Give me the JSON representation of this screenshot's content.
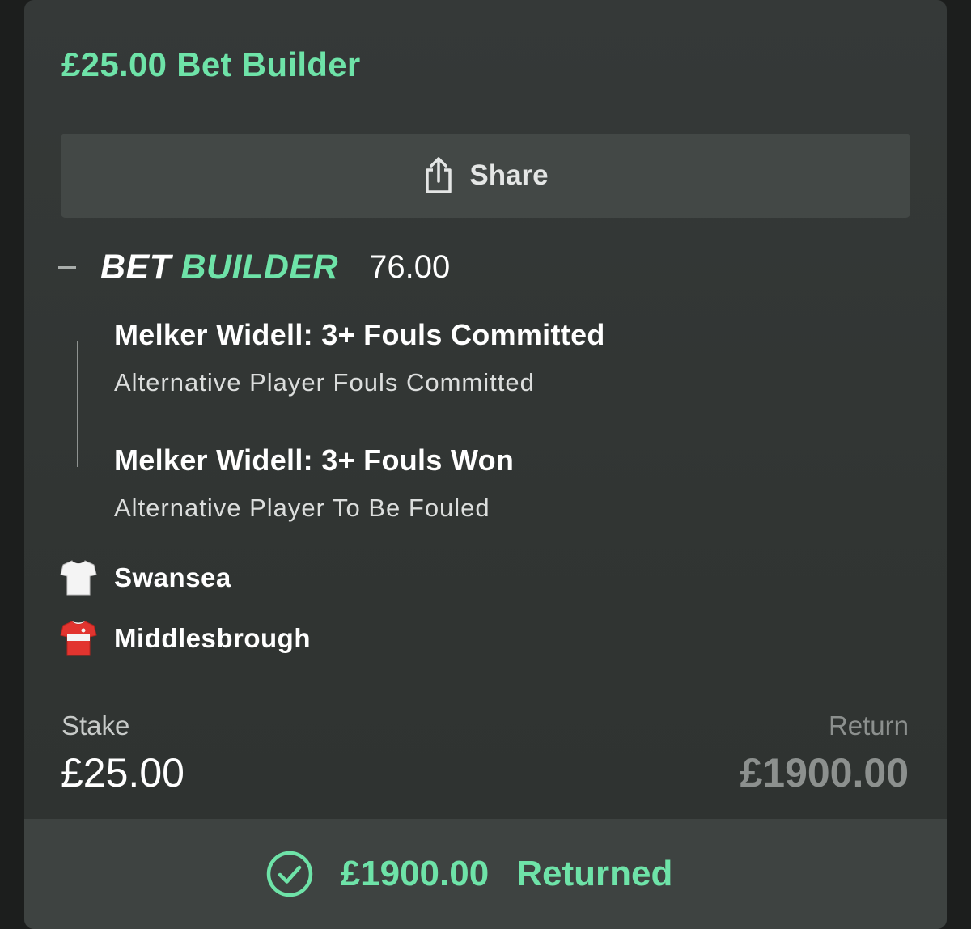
{
  "header": {
    "title": "£25.00 Bet Builder"
  },
  "share": {
    "label": "Share",
    "icon": "share-icon"
  },
  "bet_builder": {
    "word1": "BET",
    "word2": "BUILDER",
    "odds": "76.00",
    "collapse_icon": "minus-icon"
  },
  "legs": [
    {
      "selection": "Melker Widell: 3+ Fouls Committed",
      "market": "Alternative Player Fouls Committed"
    },
    {
      "selection": "Melker Widell: 3+ Fouls Won",
      "market": "Alternative Player To Be Fouled"
    }
  ],
  "teams": [
    {
      "name": "Swansea",
      "shirt_color": "#ffffff",
      "icon": "swansea-shirt-icon"
    },
    {
      "name": "Middlesbrough",
      "shirt_color": "#e2342f",
      "icon": "middlesbrough-shirt-icon"
    }
  ],
  "summary": {
    "stake_label": "Stake",
    "stake_value": "£25.00",
    "return_label": "Return",
    "return_value": "£1900.00"
  },
  "result": {
    "amount": "£1900.00",
    "status": "Returned",
    "icon": "check-circle-icon"
  },
  "colors": {
    "accent": "#6ee3a8",
    "card_bg": "#333736",
    "button_bg": "#434846",
    "footer_bg": "#3e4341"
  }
}
